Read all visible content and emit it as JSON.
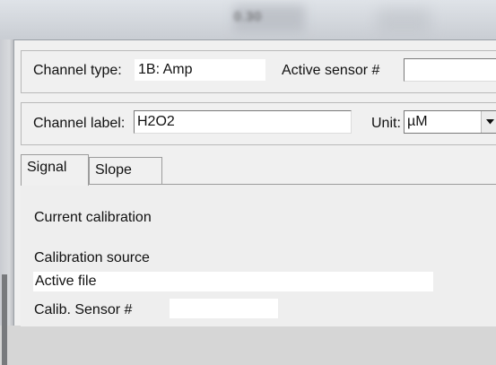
{
  "window": {
    "title": "0.30"
  },
  "channel": {
    "type_label": "Channel type:",
    "type_value": "1B: Amp",
    "active_sensor_label": "Active sensor #",
    "active_sensor_value": ""
  },
  "label_row": {
    "channel_label_label": "Channel label:",
    "channel_label_value": "H2O2",
    "unit_label": "Unit:",
    "unit_value": "µM"
  },
  "tabs": [
    {
      "label": "Signal",
      "active": true
    },
    {
      "label": "Slope",
      "active": false
    }
  ],
  "signal_panel": {
    "current_calibration_label": "Current calibration",
    "calibration_source_label": "Calibration source",
    "calibration_source_value": "Active file",
    "calib_sensor_label": "Calib. Sensor #",
    "calib_sensor_value": ""
  }
}
